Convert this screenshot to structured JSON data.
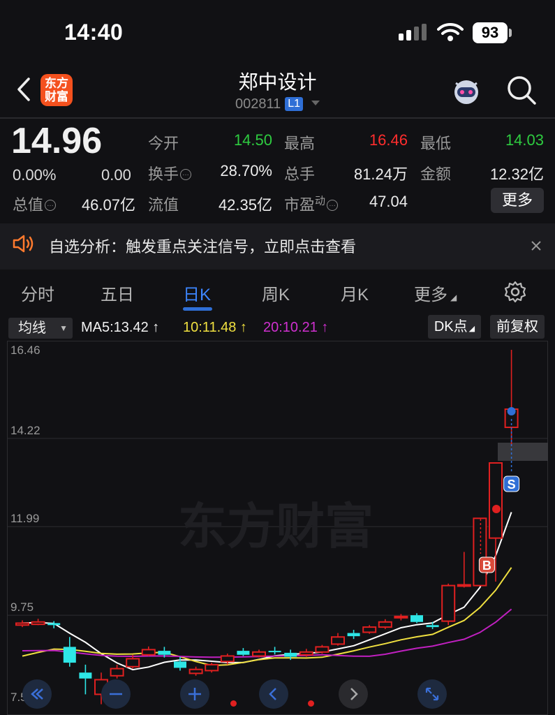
{
  "status_bar": {
    "time": "14:40",
    "battery": "93"
  },
  "header": {
    "logo_line1": "东方",
    "logo_line2": "财富",
    "title": "郑中设计",
    "code": "002811",
    "level": "L1"
  },
  "quote": {
    "price": "14.96",
    "change_pct": "0.00%",
    "change_val": "0.00",
    "open_label": "今开",
    "open": "14.50",
    "high_label": "最高",
    "high": "16.46",
    "low_label": "最低",
    "low": "14.03",
    "turnover_label": "换手",
    "turnover": "28.70%",
    "volume_label": "总手",
    "volume": "81.24万",
    "amount_label": "金额",
    "amount": "12.32亿",
    "mktcap_label": "总值",
    "mktcap": "46.07亿",
    "float_label": "流值",
    "float_cap": "42.35亿",
    "pe_label": "市盈",
    "pe_sup": "动",
    "pe": "47.04",
    "more_label": "更多"
  },
  "notice": {
    "text": "自选分析：触发重点关注信号，立即点击查看"
  },
  "tabs": [
    "分时",
    "五日",
    "日K",
    "周K",
    "月K",
    "更多"
  ],
  "active_tab": "日K",
  "toolbar": {
    "ma_select": "均线",
    "ma5": "MA5:13.42",
    "ma10": "10:11.48",
    "ma20": "20:10.21",
    "dk": "DK点",
    "fq": "前复权"
  },
  "colors": {
    "up": "#e02020",
    "down": "#2ee6e6",
    "ma5": "#ffffff",
    "ma10": "#f0e040",
    "ma20": "#c020c0",
    "accent": "#2f6fd6",
    "bg": "#111114"
  },
  "chart_data": {
    "type": "candlestick",
    "y_ticks": [
      "16.46",
      "14.22",
      "11.99",
      "9.75",
      "7.51"
    ],
    "ylim": [
      7.51,
      16.46
    ],
    "watermark": "东方财富",
    "markers": [
      {
        "label": "B"
      },
      {
        "label": "S"
      }
    ],
    "candles": [
      {
        "o": 9.5,
        "c": 9.55,
        "h": 9.62,
        "l": 9.45
      },
      {
        "o": 9.52,
        "c": 9.58,
        "h": 9.66,
        "l": 9.5
      },
      {
        "o": 9.55,
        "c": 9.5,
        "h": 9.6,
        "l": 9.42
      },
      {
        "o": 8.95,
        "c": 8.55,
        "h": 9.2,
        "l": 8.45
      },
      {
        "o": 8.3,
        "c": 8.15,
        "h": 8.5,
        "l": 7.75
      },
      {
        "o": 7.75,
        "c": 8.12,
        "h": 8.3,
        "l": 7.5
      },
      {
        "o": 8.22,
        "c": 8.4,
        "h": 8.5,
        "l": 8.15
      },
      {
        "o": 8.45,
        "c": 8.65,
        "h": 8.75,
        "l": 8.4
      },
      {
        "o": 8.75,
        "c": 8.88,
        "h": 8.96,
        "l": 8.72
      },
      {
        "o": 8.85,
        "c": 8.75,
        "h": 8.95,
        "l": 8.68
      },
      {
        "o": 8.58,
        "c": 8.42,
        "h": 8.7,
        "l": 8.35
      },
      {
        "o": 8.28,
        "c": 8.38,
        "h": 8.45,
        "l": 8.22
      },
      {
        "o": 8.35,
        "c": 8.5,
        "h": 8.55,
        "l": 8.3
      },
      {
        "o": 8.58,
        "c": 8.72,
        "h": 8.78,
        "l": 8.5
      },
      {
        "o": 8.85,
        "c": 8.75,
        "h": 8.92,
        "l": 8.72
      },
      {
        "o": 8.72,
        "c": 8.82,
        "h": 8.88,
        "l": 8.68
      },
      {
        "o": 8.85,
        "c": 8.82,
        "h": 8.95,
        "l": 8.76
      },
      {
        "o": 8.8,
        "c": 8.7,
        "h": 8.88,
        "l": 8.62
      },
      {
        "o": 8.75,
        "c": 8.82,
        "h": 8.9,
        "l": 8.7
      },
      {
        "o": 8.82,
        "c": 8.95,
        "h": 9.0,
        "l": 8.78
      },
      {
        "o": 9.02,
        "c": 9.2,
        "h": 9.3,
        "l": 8.98
      },
      {
        "o": 9.3,
        "c": 9.22,
        "h": 9.38,
        "l": 9.15
      },
      {
        "o": 9.32,
        "c": 9.45,
        "h": 9.5,
        "l": 9.28
      },
      {
        "o": 9.45,
        "c": 9.58,
        "h": 9.65,
        "l": 9.4
      },
      {
        "o": 9.7,
        "c": 9.72,
        "h": 9.78,
        "l": 9.62
      },
      {
        "o": 9.75,
        "c": 9.58,
        "h": 9.8,
        "l": 9.55
      },
      {
        "o": 9.5,
        "c": 9.45,
        "h": 9.58,
        "l": 9.4
      },
      {
        "o": 9.6,
        "c": 10.5,
        "h": 10.55,
        "l": 9.5
      },
      {
        "o": 10.52,
        "c": 10.52,
        "h": 11.35,
        "l": 10.45
      },
      {
        "o": 10.5,
        "c": 12.2,
        "h": 12.2,
        "l": 10.5
      },
      {
        "o": 11.7,
        "c": 13.6,
        "h": 13.6,
        "l": 10.6
      },
      {
        "o": 14.5,
        "c": 14.96,
        "h": 16.46,
        "l": 14.03
      }
    ]
  },
  "bottom_controls": [
    "double-left",
    "zoom-out",
    "zoom-in",
    "prev",
    "next",
    "fullscreen"
  ]
}
